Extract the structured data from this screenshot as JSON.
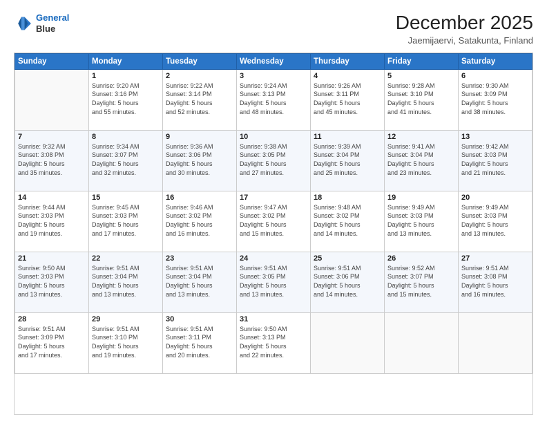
{
  "logo": {
    "line1": "General",
    "line2": "Blue"
  },
  "title": "December 2025",
  "subtitle": "Jaemijaervi, Satakunta, Finland",
  "header": {
    "days": [
      "Sunday",
      "Monday",
      "Tuesday",
      "Wednesday",
      "Thursday",
      "Friday",
      "Saturday"
    ]
  },
  "weeks": [
    {
      "cells": [
        {
          "day": "",
          "info": ""
        },
        {
          "day": "1",
          "info": "Sunrise: 9:20 AM\nSunset: 3:16 PM\nDaylight: 5 hours\nand 55 minutes."
        },
        {
          "day": "2",
          "info": "Sunrise: 9:22 AM\nSunset: 3:14 PM\nDaylight: 5 hours\nand 52 minutes."
        },
        {
          "day": "3",
          "info": "Sunrise: 9:24 AM\nSunset: 3:13 PM\nDaylight: 5 hours\nand 48 minutes."
        },
        {
          "day": "4",
          "info": "Sunrise: 9:26 AM\nSunset: 3:11 PM\nDaylight: 5 hours\nand 45 minutes."
        },
        {
          "day": "5",
          "info": "Sunrise: 9:28 AM\nSunset: 3:10 PM\nDaylight: 5 hours\nand 41 minutes."
        },
        {
          "day": "6",
          "info": "Sunrise: 9:30 AM\nSunset: 3:09 PM\nDaylight: 5 hours\nand 38 minutes."
        }
      ]
    },
    {
      "cells": [
        {
          "day": "7",
          "info": "Sunrise: 9:32 AM\nSunset: 3:08 PM\nDaylight: 5 hours\nand 35 minutes."
        },
        {
          "day": "8",
          "info": "Sunrise: 9:34 AM\nSunset: 3:07 PM\nDaylight: 5 hours\nand 32 minutes."
        },
        {
          "day": "9",
          "info": "Sunrise: 9:36 AM\nSunset: 3:06 PM\nDaylight: 5 hours\nand 30 minutes."
        },
        {
          "day": "10",
          "info": "Sunrise: 9:38 AM\nSunset: 3:05 PM\nDaylight: 5 hours\nand 27 minutes."
        },
        {
          "day": "11",
          "info": "Sunrise: 9:39 AM\nSunset: 3:04 PM\nDaylight: 5 hours\nand 25 minutes."
        },
        {
          "day": "12",
          "info": "Sunrise: 9:41 AM\nSunset: 3:04 PM\nDaylight: 5 hours\nand 23 minutes."
        },
        {
          "day": "13",
          "info": "Sunrise: 9:42 AM\nSunset: 3:03 PM\nDaylight: 5 hours\nand 21 minutes."
        }
      ]
    },
    {
      "cells": [
        {
          "day": "14",
          "info": "Sunrise: 9:44 AM\nSunset: 3:03 PM\nDaylight: 5 hours\nand 19 minutes."
        },
        {
          "day": "15",
          "info": "Sunrise: 9:45 AM\nSunset: 3:03 PM\nDaylight: 5 hours\nand 17 minutes."
        },
        {
          "day": "16",
          "info": "Sunrise: 9:46 AM\nSunset: 3:02 PM\nDaylight: 5 hours\nand 16 minutes."
        },
        {
          "day": "17",
          "info": "Sunrise: 9:47 AM\nSunset: 3:02 PM\nDaylight: 5 hours\nand 15 minutes."
        },
        {
          "day": "18",
          "info": "Sunrise: 9:48 AM\nSunset: 3:02 PM\nDaylight: 5 hours\nand 14 minutes."
        },
        {
          "day": "19",
          "info": "Sunrise: 9:49 AM\nSunset: 3:03 PM\nDaylight: 5 hours\nand 13 minutes."
        },
        {
          "day": "20",
          "info": "Sunrise: 9:49 AM\nSunset: 3:03 PM\nDaylight: 5 hours\nand 13 minutes."
        }
      ]
    },
    {
      "cells": [
        {
          "day": "21",
          "info": "Sunrise: 9:50 AM\nSunset: 3:03 PM\nDaylight: 5 hours\nand 13 minutes."
        },
        {
          "day": "22",
          "info": "Sunrise: 9:51 AM\nSunset: 3:04 PM\nDaylight: 5 hours\nand 13 minutes."
        },
        {
          "day": "23",
          "info": "Sunrise: 9:51 AM\nSunset: 3:04 PM\nDaylight: 5 hours\nand 13 minutes."
        },
        {
          "day": "24",
          "info": "Sunrise: 9:51 AM\nSunset: 3:05 PM\nDaylight: 5 hours\nand 13 minutes."
        },
        {
          "day": "25",
          "info": "Sunrise: 9:51 AM\nSunset: 3:06 PM\nDaylight: 5 hours\nand 14 minutes."
        },
        {
          "day": "26",
          "info": "Sunrise: 9:52 AM\nSunset: 3:07 PM\nDaylight: 5 hours\nand 15 minutes."
        },
        {
          "day": "27",
          "info": "Sunrise: 9:51 AM\nSunset: 3:08 PM\nDaylight: 5 hours\nand 16 minutes."
        }
      ]
    },
    {
      "cells": [
        {
          "day": "28",
          "info": "Sunrise: 9:51 AM\nSunset: 3:09 PM\nDaylight: 5 hours\nand 17 minutes."
        },
        {
          "day": "29",
          "info": "Sunrise: 9:51 AM\nSunset: 3:10 PM\nDaylight: 5 hours\nand 19 minutes."
        },
        {
          "day": "30",
          "info": "Sunrise: 9:51 AM\nSunset: 3:11 PM\nDaylight: 5 hours\nand 20 minutes."
        },
        {
          "day": "31",
          "info": "Sunrise: 9:50 AM\nSunset: 3:13 PM\nDaylight: 5 hours\nand 22 minutes."
        },
        {
          "day": "",
          "info": ""
        },
        {
          "day": "",
          "info": ""
        },
        {
          "day": "",
          "info": ""
        }
      ]
    }
  ]
}
